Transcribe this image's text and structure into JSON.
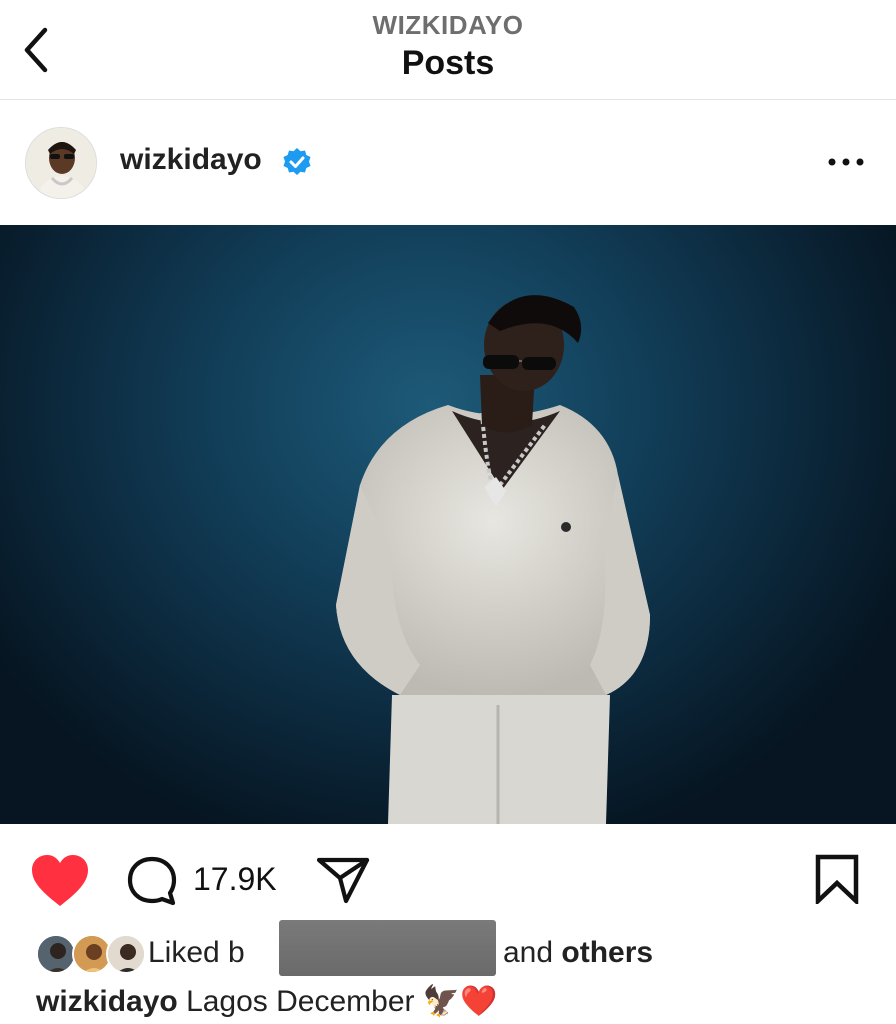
{
  "header": {
    "subtitle": "WIZKIDAYO",
    "title": "Posts"
  },
  "post": {
    "username": "wizkidayo",
    "comment_count": "17.9K",
    "likes": {
      "prefix": "Liked b",
      "suffix": "and",
      "others": "others"
    },
    "caption": {
      "username": "wizkidayo",
      "text": "Lagos December",
      "emoji": "🦅❤️"
    }
  },
  "icons": [
    "back-icon",
    "verified-icon",
    "more-icon",
    "heart-icon",
    "comment-icon",
    "share-icon",
    "bookmark-icon"
  ],
  "colors": {
    "like_red": "#ff3040",
    "verified_blue": "#1d9bf0",
    "photo_bg": "#0d3047"
  }
}
